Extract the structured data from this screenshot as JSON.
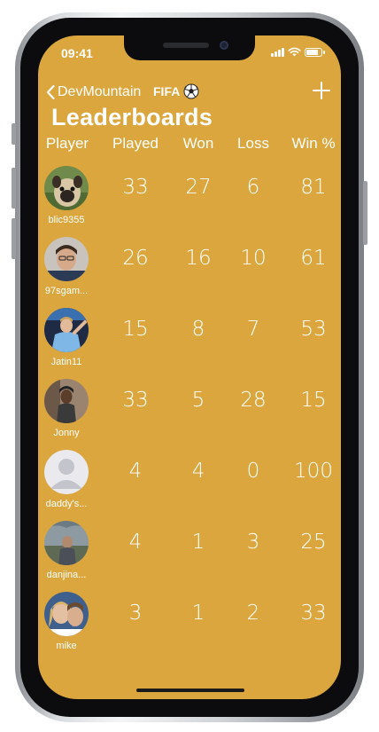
{
  "status_bar": {
    "time": "09:41"
  },
  "nav": {
    "back_label": "DevMountain",
    "title": "FIFA",
    "add_icon": "plus-icon"
  },
  "heading": "Leaderboards",
  "columns": [
    "Player",
    "Played",
    "Won",
    "Loss",
    "Win %"
  ],
  "players": [
    {
      "name": "blic9355",
      "avatar": "pug-photo",
      "played": "33",
      "won": "27",
      "loss": "6",
      "win_pct": "81"
    },
    {
      "name": "97sgam...",
      "avatar": "man-photo",
      "played": "26",
      "won": "16",
      "loss": "10",
      "win_pct": "61"
    },
    {
      "name": "Jatin11",
      "avatar": "footballer-photo",
      "played": "15",
      "won": "8",
      "loss": "7",
      "win_pct": "53"
    },
    {
      "name": "Jonny",
      "avatar": "person-photo",
      "played": "33",
      "won": "5",
      "loss": "28",
      "win_pct": "15"
    },
    {
      "name": "daddy's...",
      "avatar": "default-avatar",
      "played": "4",
      "won": "4",
      "loss": "0",
      "win_pct": "100"
    },
    {
      "name": "danjina...",
      "avatar": "outdoor-photo",
      "played": "4",
      "won": "1",
      "loss": "3",
      "win_pct": "25"
    },
    {
      "name": "mike",
      "avatar": "selfie-photo",
      "played": "3",
      "won": "1",
      "loss": "2",
      "win_pct": "33"
    }
  ],
  "colors": {
    "background": "#daa63d",
    "text": "#ffffff"
  }
}
